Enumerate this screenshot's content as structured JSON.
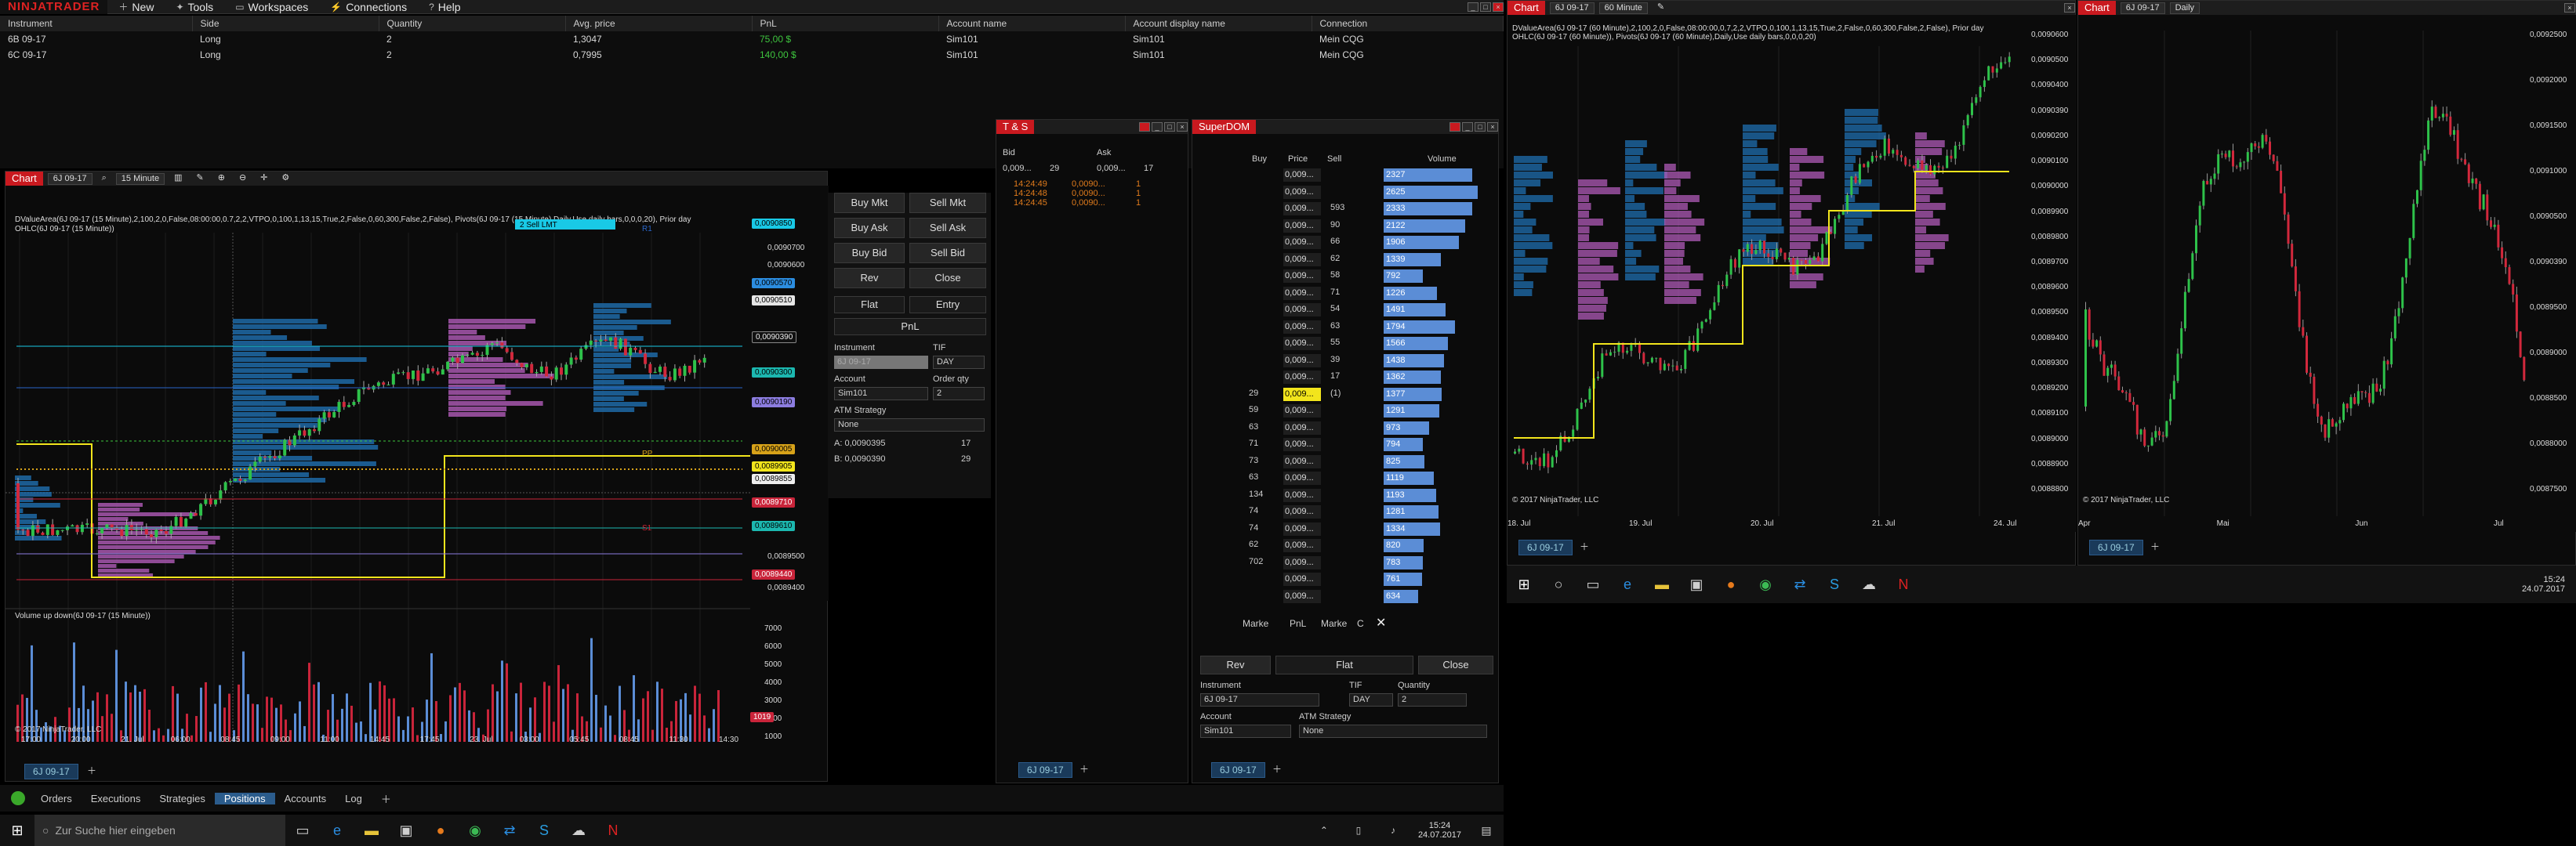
{
  "app": {
    "logo": "NINJATRADER"
  },
  "menu": [
    "New",
    "Tools",
    "Workspaces",
    "Connections",
    "Help"
  ],
  "positions": {
    "headers": [
      "Instrument",
      "Side",
      "Quantity",
      "Avg. price",
      "PnL",
      "Account name",
      "Account display name",
      "Connection"
    ],
    "rows": [
      [
        "6B 09-17",
        "Long",
        "2",
        "1,3047",
        "75,00 $",
        "Sim101",
        "Sim101",
        "Mein CQG"
      ],
      [
        "6C 09-17",
        "Long",
        "2",
        "0,7995",
        "140,00 $",
        "Sim101",
        "Sim101",
        "Mein CQG"
      ]
    ]
  },
  "chart1": {
    "title": "Chart",
    "instrument": "6J 09-17",
    "interval": "15 Minute",
    "indicator_line1": "DValueArea(6J 09-17 (15 Minute),2,100,2,0,False,08:00:00,0.7,2,2,VTPO,0,100,1,13,15,True,2,False,0,60,300,False,2,False), Pivots(6J 09-17 (15 Minute),Daily,Use daily bars,0,0,0,20), Prior day",
    "indicator_line2": "OHLC(6J 09-17 (15 Minute))",
    "order_tag": "2  Sell LMT",
    "price_tags": [
      "0,0090850",
      "0,0090570",
      "0,0090510",
      "0,0090390",
      "0,0090300",
      "0,0090190",
      "0,0090005",
      "0,0089905",
      "0,0089855",
      "0,0089710",
      "0,0089610",
      "0,0089440"
    ],
    "price_axis": [
      "0,0090700",
      "0,0090600",
      "0,0089500",
      "0,0089400"
    ],
    "pp": "PP",
    "s1": "S1",
    "r1": "R1",
    "volume_title": "Volume up down(6J 09-17 (15 Minute))",
    "volume_axis": [
      "7000",
      "6000",
      "5000",
      "4000",
      "3000",
      "2000",
      "1000"
    ],
    "volume_tag": "1019",
    "copyright": "© 2017 NinjaTrader, LLC",
    "time_axis": [
      "17:00",
      "20:00",
      "21. Jul",
      "06:00",
      "08:45",
      "09:00",
      "11:00",
      "14:45",
      "17:45",
      "23. Jul",
      "03:00",
      "05:45",
      "08:45",
      "11:30",
      "14:30"
    ],
    "tab": "6J 09-17"
  },
  "chart_trader": {
    "buttons": [
      "Buy Mkt",
      "Sell Mkt",
      "Buy Ask",
      "Sell Ask",
      "Buy Bid",
      "Sell Bid",
      "Rev",
      "Close",
      "Flat",
      "Entry",
      "PnL"
    ],
    "instrument_label": "Instrument",
    "instrument_value": "6J 09-17",
    "tif_label": "TIF",
    "tif_value": "DAY",
    "account_label": "Account",
    "account_value": "Sim101",
    "orderqty_label": "Order qty",
    "orderqty_value": "2",
    "atm_label": "ATM Strategy",
    "atm_value": "None",
    "a_line": "A:  0,0090395",
    "a_qty": "17",
    "b_line": "B:  0,0090390",
    "b_qty": "29"
  },
  "ts": {
    "title": "T & S",
    "bid_label": "Bid",
    "ask_label": "Ask",
    "bid_price": "0,009...",
    "bid_size": "29",
    "ask_price": "0,009...",
    "ask_size": "17",
    "rows": [
      [
        "14:24:49",
        "0,0090...",
        "1"
      ],
      [
        "14:24:48",
        "0,0090...",
        "1"
      ],
      [
        "14:24:45",
        "0,0090...",
        "1"
      ]
    ],
    "tab": "6J 09-17"
  },
  "dom": {
    "title": "SuperDOM",
    "headers": [
      "Buy",
      "Price",
      "Sell",
      "Volume"
    ],
    "price_label": "0,009...",
    "sells": [
      "",
      "",
      "593",
      "90",
      "66",
      "62",
      "58",
      "71",
      "54",
      "63",
      "55",
      "39",
      "17",
      "(1)"
    ],
    "buys": [
      "29",
      "59",
      "63",
      "71",
      "73",
      "63",
      "134",
      "74",
      "74",
      "62",
      "702",
      "",
      "",
      ""
    ],
    "volumes": [
      "2327",
      "2625",
      "2333",
      "2122",
      "1906",
      "1339",
      "792",
      "1226",
      "1491",
      "1794",
      "1566",
      "1438",
      "1362",
      "1377",
      "1291",
      "973",
      "794",
      "825",
      "1119",
      "1193",
      "1281",
      "1334",
      "820",
      "783",
      "761",
      "634"
    ],
    "bottom_labels": [
      "Marke",
      "PnL",
      "Marke",
      "C"
    ],
    "rev": "Rev",
    "flat": "Flat",
    "close": "Close",
    "instrument_label": "Instrument",
    "instrument_value": "6J 09-17",
    "tif_label": "TIF",
    "tif_value": "DAY",
    "qty_label": "Quantity",
    "qty_value": "2",
    "account_label": "Account",
    "account_value": "Sim101",
    "atm_label": "ATM Strategy",
    "atm_value": "None",
    "tab": "6J 09-17"
  },
  "chart2": {
    "title": "Chart",
    "instrument": "6J 09-17",
    "interval": "60 Minute",
    "indicator_line1": "DValueArea(6J 09-17 (60 Minute),2,100,2,0,False,08:00:00,0,7,2,2,VTPO,0,100,1,13,15,True,2,False,0,60,300,False,2,False), Prior day",
    "indicator_line2": "OHLC(6J 09-17 (60 Minute)), Pivots(6J 09-17 (60 Minute),Daily,Use daily bars,0,0,0,20)",
    "price_axis": [
      "0,0090600",
      "0,0090500",
      "0,0090400",
      "0,0090390",
      "0,0090200",
      "0,0090100",
      "0,0090000",
      "0,0089900",
      "0,0089800",
      "0,0089700",
      "0,0089600",
      "0,0089500",
      "0,0089400",
      "0,0089300",
      "0,0089200",
      "0,0089100",
      "0,0089000",
      "0,0088900",
      "0,0088800"
    ],
    "time_axis": [
      "18. Jul",
      "19. Jul",
      "20. Jul",
      "21. Jul",
      "24. Jul"
    ],
    "copyright": "© 2017 NinjaTrader, LLC",
    "tab": "6J 09-17"
  },
  "chart3": {
    "title": "Chart",
    "instrument": "6J 09-17",
    "interval": "Daily",
    "price_axis": [
      "0,0092500",
      "0,0092000",
      "0,0091500",
      "0,0091000",
      "0,0090500",
      "0,0090390",
      "0,0089500",
      "0,0089000",
      "0,0088500",
      "0,0088000",
      "0,0087500"
    ],
    "time_axis": [
      "Apr",
      "Mai",
      "Jun",
      "Jul"
    ],
    "copyright": "© 2017 NinjaTrader, LLC",
    "tab": "6J 09-17"
  },
  "bottom_tabs": [
    "Orders",
    "Executions",
    "Strategies",
    "Positions",
    "Accounts",
    "Log"
  ],
  "taskbar": {
    "search_placeholder": "Zur Suche hier eingeben",
    "time": "15:24",
    "date": "24.07.2017"
  },
  "taskbar2": {
    "time": "15:24",
    "date": "24.07.2017"
  }
}
